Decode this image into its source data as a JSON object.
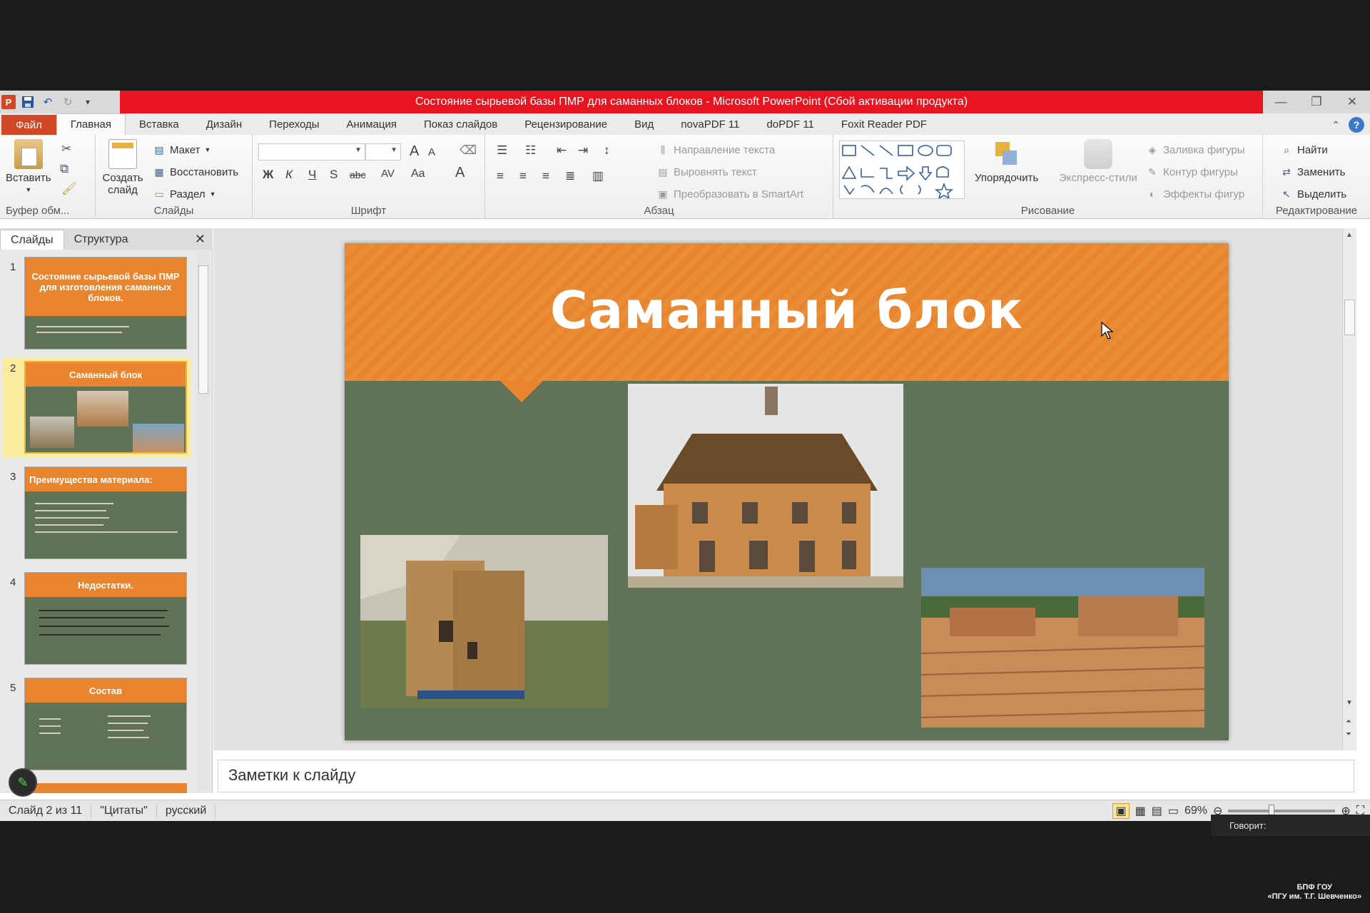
{
  "window": {
    "title": "Состояние сырьевой базы ПМР для саманных блоков  -  Microsoft PowerPoint (Сбой активации продукта)",
    "app_icon": "P"
  },
  "tabs": [
    "Файл",
    "Главная",
    "Вставка",
    "Дизайн",
    "Переходы",
    "Анимация",
    "Показ слайдов",
    "Рецензирование",
    "Вид",
    "novaPDF 11",
    "doPDF 11",
    "Foxit Reader PDF"
  ],
  "ribbon": {
    "clipboard": {
      "paste": "Вставить",
      "label": "Буфер обм..."
    },
    "slides": {
      "new_slide": "Создать слайд",
      "layout": "Макет",
      "reset": "Восстановить",
      "section": "Раздел",
      "label": "Слайды"
    },
    "font": {
      "label": "Шрифт",
      "bold": "Ж",
      "italic": "К",
      "underline": "Ч",
      "strike": "S",
      "size_up": "A",
      "size_down": "A",
      "case": "Aa",
      "color": "A"
    },
    "paragraph": {
      "text_direction": "Направление текста",
      "align_text": "Выровнять текст",
      "smartart": "Преобразовать в SmartArt",
      "label": "Абзац"
    },
    "drawing": {
      "arrange": "Упорядочить",
      "quick_styles": "Экспресс-стили",
      "fill": "Заливка фигуры",
      "outline": "Контур фигуры",
      "effects": "Эффекты фигур",
      "label": "Рисование"
    },
    "editing": {
      "find": "Найти",
      "replace": "Заменить",
      "select": "Выделить",
      "label": "Редактирование"
    }
  },
  "left_pane": {
    "tab_slides": "Слайды",
    "tab_outline": "Структура",
    "thumbnails": [
      {
        "num": "1",
        "title": "Состояние  сырьевой базы ПМР для изготовления саманных блоков."
      },
      {
        "num": "2",
        "title": "Саманный блок"
      },
      {
        "num": "3",
        "title": "Преимущества материала:"
      },
      {
        "num": "4",
        "title": "Недостатки."
      },
      {
        "num": "5",
        "title": "Состав"
      }
    ]
  },
  "slide": {
    "title": "Саманный блок"
  },
  "notes": {
    "placeholder": "Заметки к слайду"
  },
  "status": {
    "slide_pos": "Слайд 2 из 11",
    "theme": "\"Цитаты\"",
    "language": "русский",
    "zoom": "69%",
    "zoom_percent": 69
  },
  "overlay": {
    "speaking": "Говорит:",
    "watermark_1": "БПФ ГОУ",
    "watermark_2": "«ПГУ им. Т.Г. Шевченко»"
  },
  "colors": {
    "accent": "#e8852e",
    "slide_bg": "#617356",
    "title_bar": "#e8141f",
    "file_tab": "#d24726"
  }
}
